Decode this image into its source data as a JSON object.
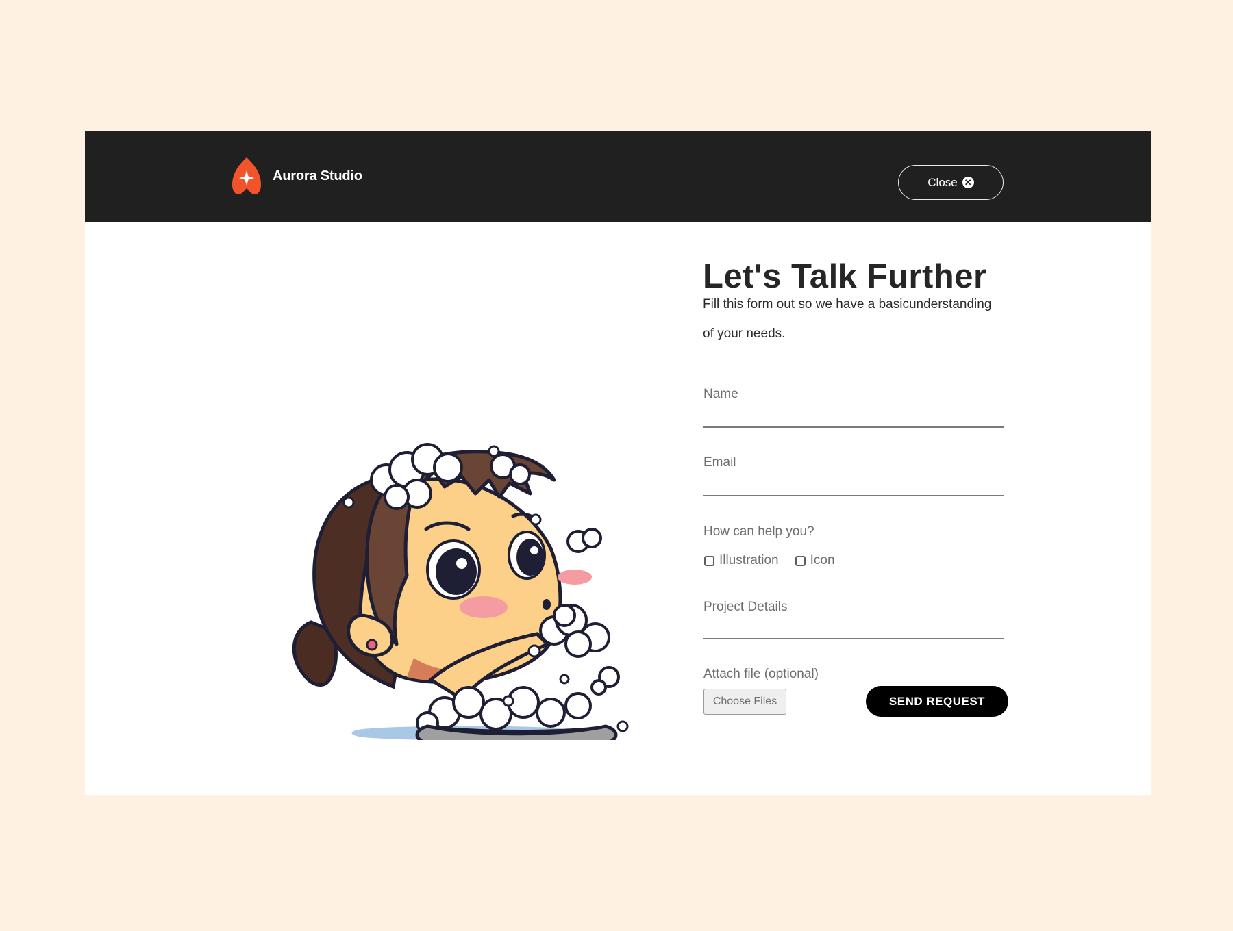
{
  "header": {
    "brand_name": "Aurora Studio",
    "close_label": "Close"
  },
  "form": {
    "title": "Let's Talk Further",
    "subtitle": "Fill this form out so we have a basicunderstanding of your needs.",
    "name_label": "Name",
    "email_label": "Email",
    "help_label": "How can help you?",
    "options": [
      {
        "label": "Illustration",
        "checked": false
      },
      {
        "label": "Icon",
        "checked": false
      }
    ],
    "details_label": "Project Details",
    "attach_label": "Attach file (optional)",
    "choose_files_label": "Choose Files",
    "send_label": "SEND REQUEST"
  },
  "colors": {
    "page_background": "#fef1e1",
    "header_background": "#202020",
    "brand_accent": "#f1542b",
    "button_background": "#000000"
  },
  "icons": [
    "aurora-logo-icon",
    "close-circle-icon",
    "checkbox-icon"
  ]
}
